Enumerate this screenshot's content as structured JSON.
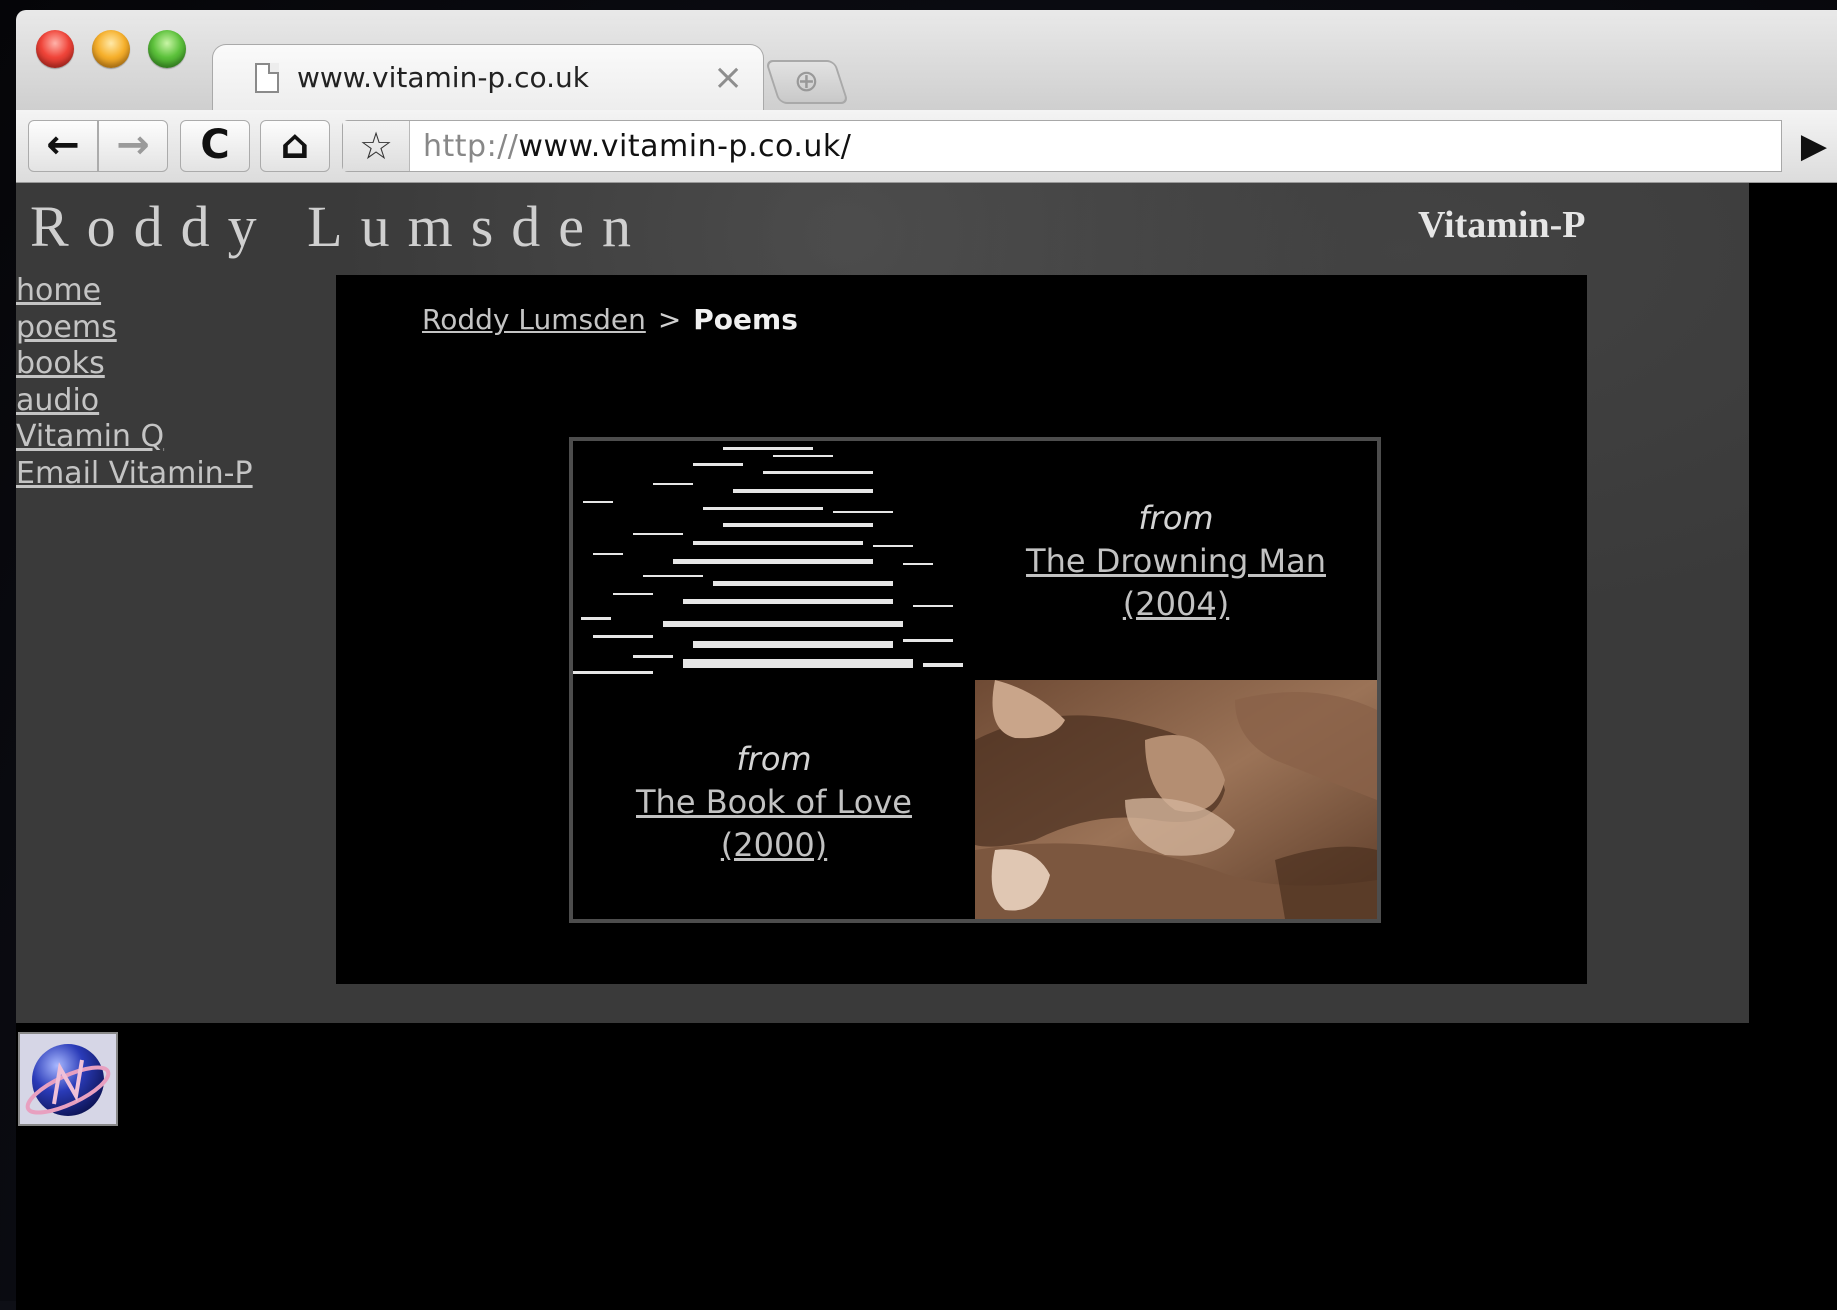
{
  "browser": {
    "tab_title": "www.vitamin-p.co.uk",
    "tab_close_glyph": "×",
    "new_tab_glyph": "⊕",
    "back_glyph": "←",
    "forward_glyph": "→",
    "reload_glyph": "C",
    "home_glyph": "⌂",
    "bookmark_glyph": "☆",
    "url_scheme": "http://",
    "url_rest": "www.vitamin-p.co.uk/",
    "go_glyph": "▶"
  },
  "site": {
    "title": "Roddy Lumsden",
    "brand": "Vitamin-P",
    "nav": [
      {
        "label": "home"
      },
      {
        "label": "poems"
      },
      {
        "label": "books"
      },
      {
        "label": "audio"
      },
      {
        "label": "Vitamin Q"
      },
      {
        "label": "Email Vitamin-P"
      }
    ],
    "breadcrumb": {
      "parent": "Roddy Lumsden",
      "separator": ">",
      "current": "Poems"
    },
    "books": [
      {
        "from": "from",
        "title": "The Drowning Man",
        "year": "(2004)"
      },
      {
        "from": "from",
        "title": "The Book of Love",
        "year": "(2000)"
      }
    ]
  },
  "colors": {
    "site_background": "#3a3a3a",
    "content_background": "#000000",
    "link": "#c4c4c4",
    "grid_border": "#4d4d4d"
  }
}
